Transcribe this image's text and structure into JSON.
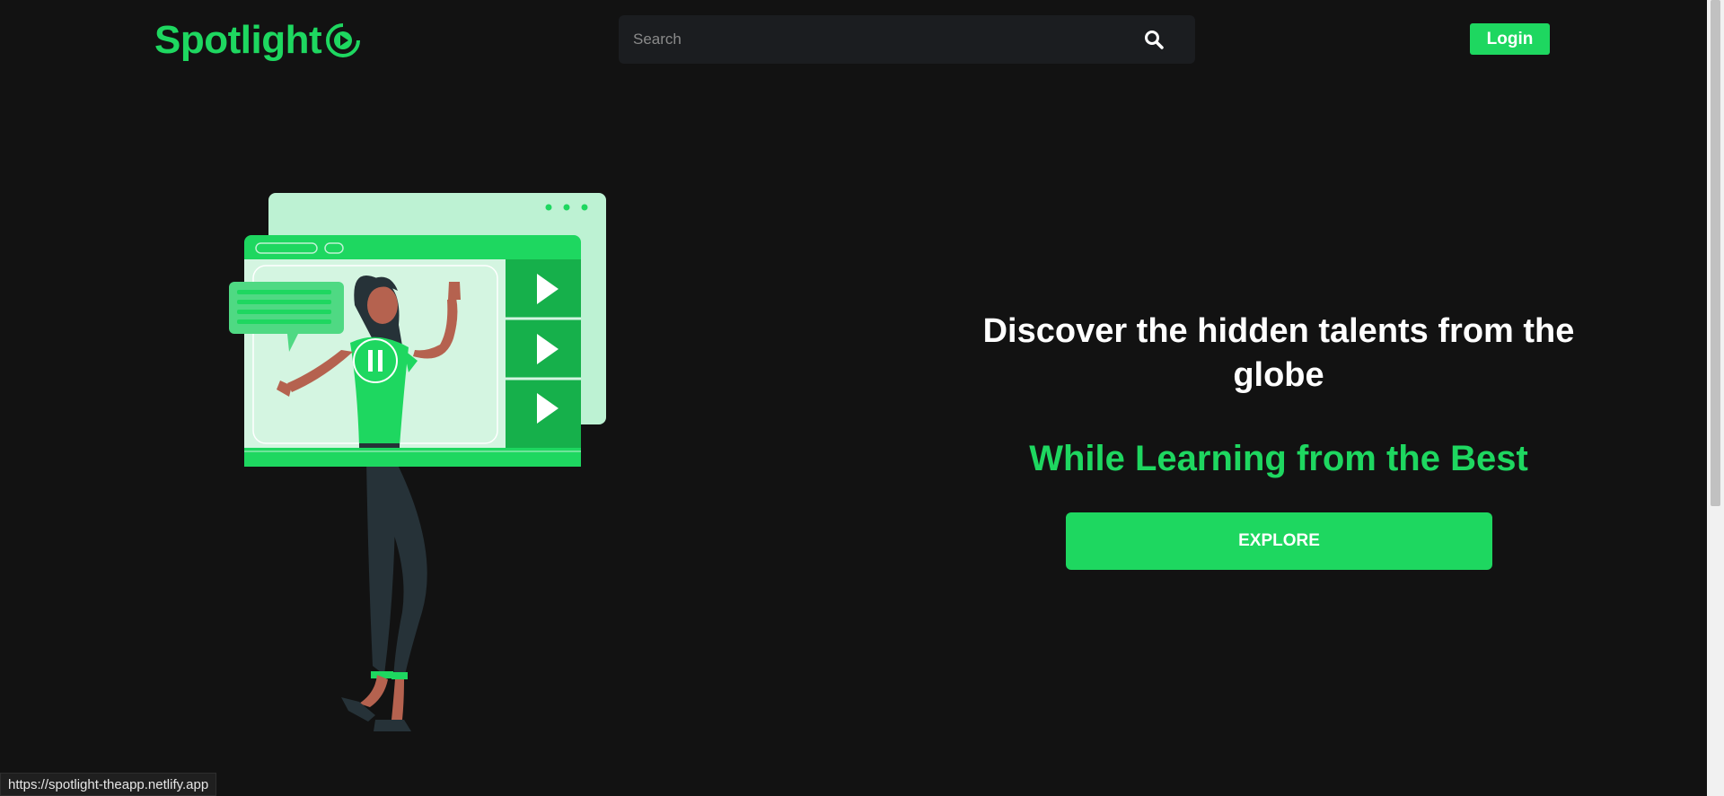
{
  "header": {
    "logo_text": "Spotlight",
    "logo_icon": "play-swirl-icon",
    "search": {
      "placeholder": "Search",
      "value": "",
      "icon": "search-icon"
    },
    "login_label": "Login"
  },
  "hero": {
    "title": "Discover the hidden talents from the globe",
    "subtitle": "While Learning from the Best",
    "explore_label": "EXPLORE",
    "illustration": "video-learning-illustration"
  },
  "status_bar": {
    "url": "https://spotlight-theapp.netlify.app"
  },
  "colors": {
    "background": "#121212",
    "accent": "#1ed760",
    "search_bg": "#1b1d20",
    "text": "#ffffff"
  }
}
